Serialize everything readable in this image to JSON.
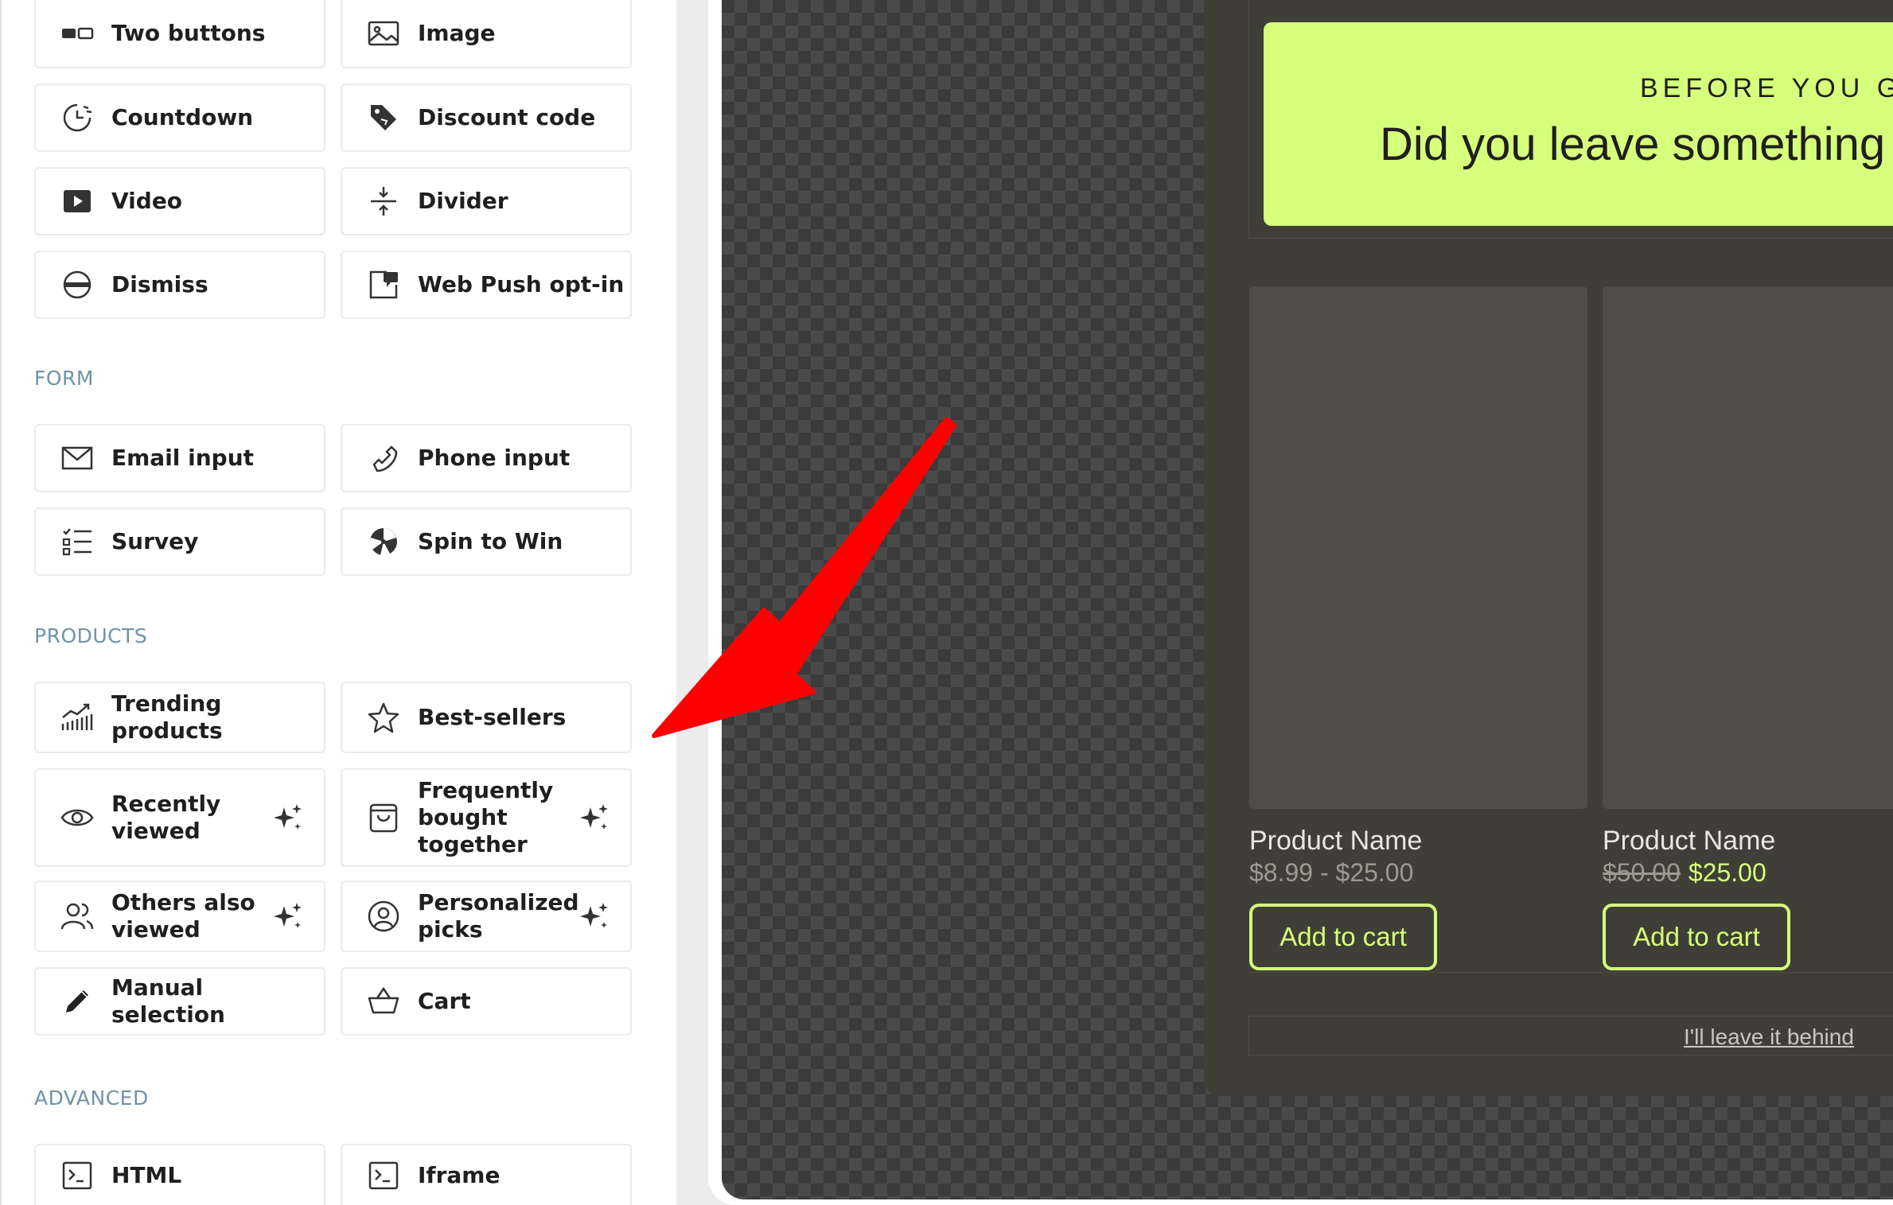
{
  "sidebar": {
    "basic_items": [
      {
        "label": "Two buttons",
        "icon": "two-buttons-icon"
      },
      {
        "label": "Image",
        "icon": "image-icon"
      },
      {
        "label": "Countdown",
        "icon": "countdown-icon"
      },
      {
        "label": "Discount code",
        "icon": "discount-tag-icon"
      },
      {
        "label": "Video",
        "icon": "video-icon"
      },
      {
        "label": "Divider",
        "icon": "divider-icon"
      },
      {
        "label": "Dismiss",
        "icon": "dismiss-icon"
      },
      {
        "label": "Web Push opt-in",
        "icon": "web-push-icon"
      }
    ],
    "form_section": "FORM",
    "form_items": [
      {
        "label": "Email input",
        "icon": "envelope-icon"
      },
      {
        "label": "Phone input",
        "icon": "phone-icon"
      },
      {
        "label": "Survey",
        "icon": "survey-list-icon"
      },
      {
        "label": "Spin to Win",
        "icon": "wheel-icon"
      }
    ],
    "products_section": "PRODUCTS",
    "product_items": [
      {
        "label": "Trending\nproducts",
        "icon": "trending-chart-icon"
      },
      {
        "label": "Best-sellers",
        "icon": "star-icon"
      },
      {
        "label": "Recently\nviewed",
        "icon": "eye-icon",
        "ai": true
      },
      {
        "label": "Frequently\nbought\ntogether",
        "icon": "shopping-bag-icon",
        "ai": true
      },
      {
        "label": "Others also\nviewed",
        "icon": "users-icon",
        "ai": true
      },
      {
        "label": "Personalized\npicks",
        "icon": "user-circle-icon",
        "ai": true
      },
      {
        "label": "Manual selection",
        "icon": "pencil-icon"
      },
      {
        "label": "Cart",
        "icon": "basket-icon"
      }
    ],
    "advanced_section": "ADVANCED",
    "advanced_items": [
      {
        "label": "HTML",
        "icon": "terminal-icon"
      },
      {
        "label": "Iframe",
        "icon": "iframe-terminal-icon"
      }
    ]
  },
  "popup": {
    "eyebrow": "BEFORE YOU GO",
    "headline": "Did you leave something",
    "products": [
      {
        "name": "Product Name",
        "price_range": "$8.99 - $25.00",
        "button": "Add to cart"
      },
      {
        "name": "Product Name",
        "old_price": "$50.00",
        "new_price": "$25.00",
        "button": "Add to cart"
      }
    ],
    "dismiss_link": "I'll leave it behind"
  },
  "colors": {
    "accent": "#d6ff7c",
    "popup_bg": "#3f3f37",
    "section_label": "#6f93a8",
    "annotation_arrow": "#ff0000"
  }
}
